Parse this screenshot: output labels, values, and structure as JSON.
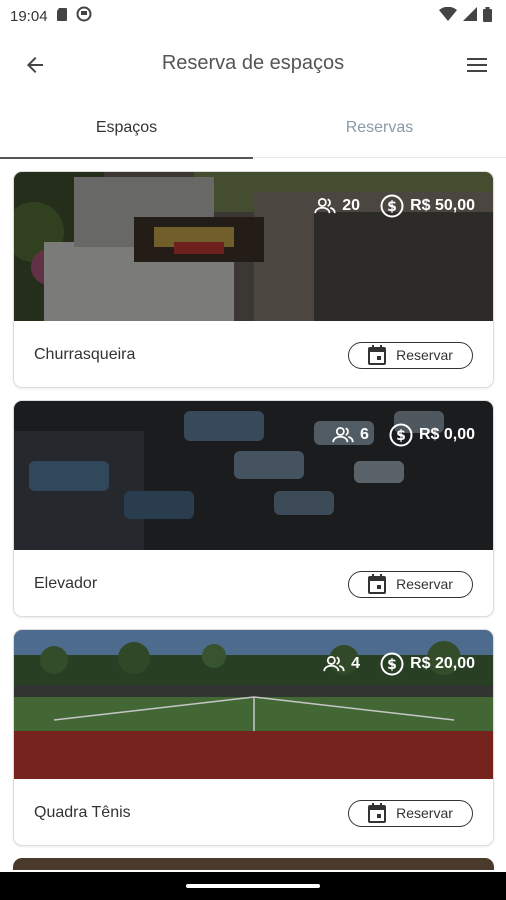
{
  "status": {
    "time": "19:04",
    "icons": [
      "sd-card-icon",
      "notification-circle-icon",
      "wifi-icon",
      "signal-icon",
      "battery-icon"
    ]
  },
  "app_bar": {
    "title": "Reserva de espaços",
    "back_icon": "arrow-left-icon",
    "menu_icon": "hamburger-menu-icon"
  },
  "tabs": [
    {
      "label": "Espaços",
      "active": true
    },
    {
      "label": "Reservas",
      "active": false
    }
  ],
  "spaces": [
    {
      "name": "Churrasqueira",
      "capacity": "20",
      "price": "R$ 50,00",
      "button_label": "Reservar"
    },
    {
      "name": "Elevador",
      "capacity": "6",
      "price": "R$ 0,00",
      "button_label": "Reservar"
    },
    {
      "name": "Quadra Tênis",
      "capacity": "4",
      "price": "R$ 20,00",
      "button_label": "Reservar"
    }
  ],
  "colors": {
    "tab_active": "#333333",
    "tab_inactive": "#8a9aa8",
    "indicator": "#555555"
  }
}
